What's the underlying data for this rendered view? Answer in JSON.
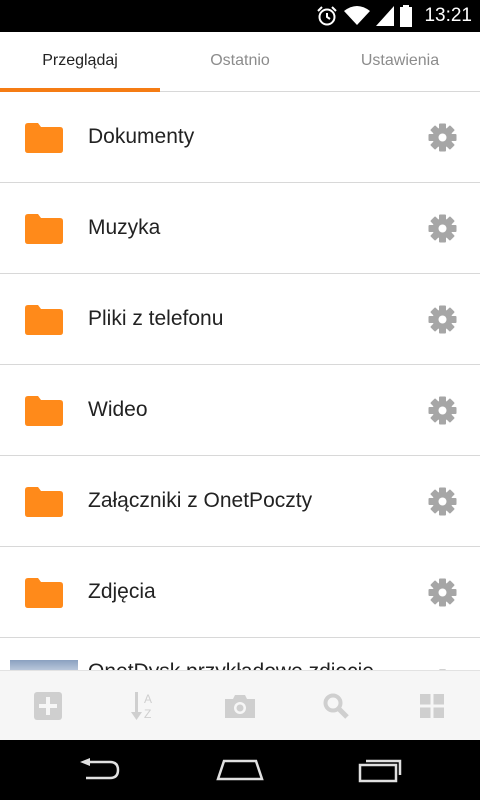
{
  "status_bar": {
    "time": "13:21",
    "icons": [
      "alarm-icon",
      "wifi-icon",
      "signal-icon",
      "battery-icon"
    ]
  },
  "tabs": [
    {
      "label": "Przeglądaj",
      "active": true
    },
    {
      "label": "Ostatnio",
      "active": false
    },
    {
      "label": "Ustawienia",
      "active": false
    }
  ],
  "folders": [
    {
      "label": "Dokumenty",
      "icon": "folder-icon"
    },
    {
      "label": "Muzyka",
      "icon": "folder-icon"
    },
    {
      "label": "Pliki z telefonu",
      "icon": "folder-icon"
    },
    {
      "label": "Wideo",
      "icon": "folder-icon"
    },
    {
      "label": "Załączniki z OnetPoczty",
      "icon": "folder-icon"
    },
    {
      "label": "Zdjęcia",
      "icon": "folder-icon"
    }
  ],
  "partial_item": {
    "label": "OnetDysk przykładowe zdjęcie"
  },
  "bottom_toolbar": [
    "add-icon",
    "sort-az-icon",
    "camera-icon",
    "search-icon",
    "grid-view-icon"
  ],
  "nav_bar": [
    "back-icon",
    "home-icon",
    "recents-icon"
  ],
  "colors": {
    "accent": "#f57c14",
    "folder": "#ff8a1a",
    "gear": "#a6a6a6",
    "toolbar_icon": "#cfcfcf"
  }
}
